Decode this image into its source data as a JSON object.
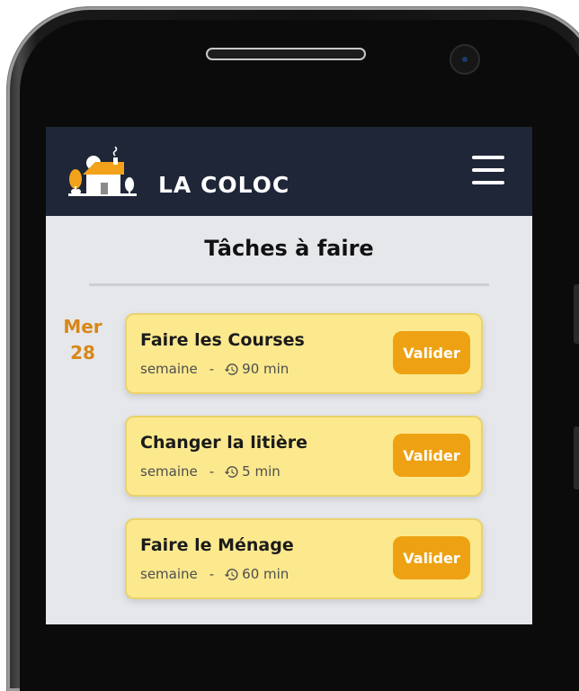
{
  "app": {
    "title": "LA COLOC",
    "logo_icon": "house-with-tree-logo-icon",
    "menu_icon": "hamburger-menu-icon"
  },
  "page": {
    "title": "Tâches à faire"
  },
  "colors": {
    "header": "#1e2638",
    "card_background": "#fce98e",
    "button": "#eea213",
    "date_accent": "#d98718",
    "screen_background": "#e6e7eb"
  },
  "day_group": {
    "weekday": "Mer",
    "day": "28"
  },
  "tasks": [
    {
      "name": "Faire les Courses",
      "frequency": "semaine",
      "separator": "-",
      "duration": "90 min",
      "button_label": "Valider"
    },
    {
      "name": "Changer la litière",
      "frequency": "semaine",
      "separator": "-",
      "duration": "5 min",
      "button_label": "Valider"
    },
    {
      "name": "Faire le Ménage",
      "frequency": "semaine",
      "separator": "-",
      "duration": "60 min",
      "button_label": "Valider"
    }
  ]
}
